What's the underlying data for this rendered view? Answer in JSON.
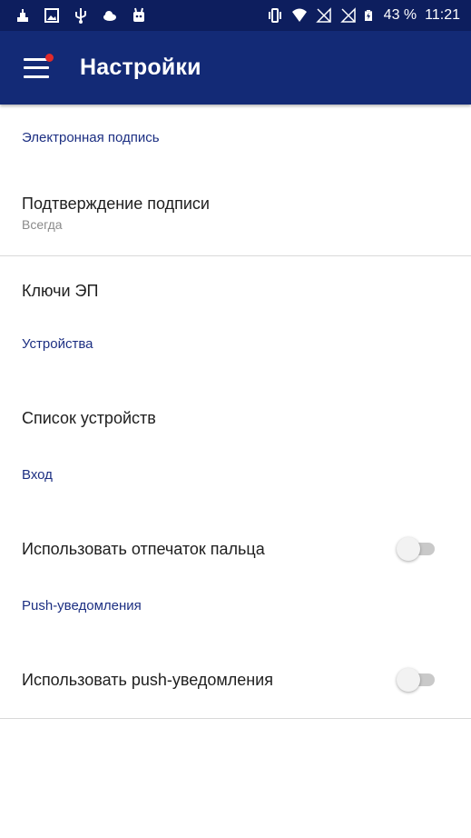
{
  "colors": {
    "status_bar": "#0d1e5e",
    "app_bar": "#132a76",
    "section_header": "#1c2f82",
    "notification_dot": "#e02a2a",
    "toggle_off_track": "#c9c9c9",
    "toggle_off_thumb": "#f2f2f2"
  },
  "status_bar": {
    "left_icons": [
      "notification-app-icon",
      "image-icon",
      "usb-icon",
      "cloud-icon",
      "android-icon"
    ],
    "right_icons": [
      "vibrate-icon",
      "wifi-icon",
      "no-sim-icon",
      "no-sim-icon",
      "battery-charging-icon"
    ],
    "battery": "43 %",
    "time": "11:21"
  },
  "app_bar": {
    "menu_icon": "menu-icon",
    "has_notification_dot": true,
    "title": "Настройки"
  },
  "sections": {
    "signature": {
      "header": "Электронная подпись",
      "confirm": {
        "title": "Подтверждение подписи",
        "summary": "Всегда"
      },
      "keys": {
        "title": "Ключи ЭП"
      }
    },
    "devices": {
      "header": "Устройства",
      "list": {
        "title": "Список устройств"
      }
    },
    "login": {
      "header": "Вход",
      "fingerprint": {
        "title": "Использовать отпечаток пальца",
        "enabled": false
      }
    },
    "push": {
      "header": "Push-уведомления",
      "use_push": {
        "title": "Использовать push-уведомления",
        "enabled": false
      }
    }
  }
}
